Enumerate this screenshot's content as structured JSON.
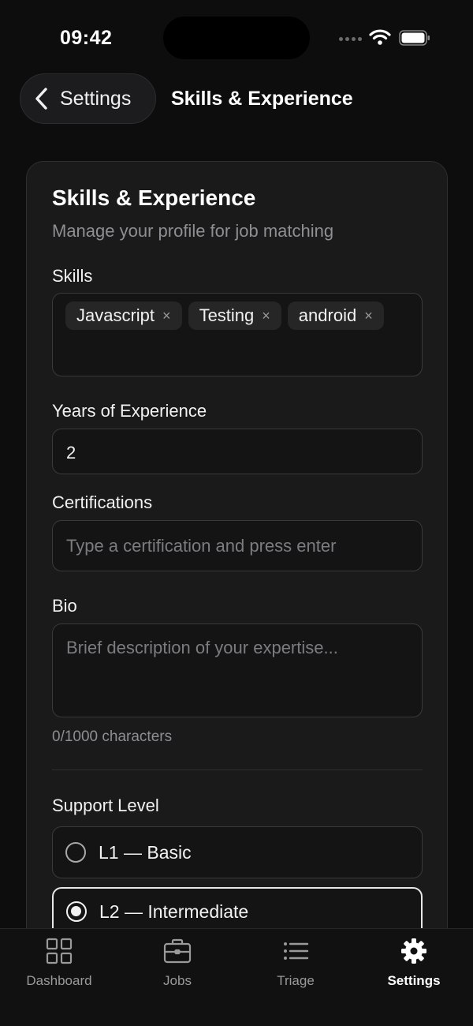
{
  "status_bar": {
    "time": "09:42"
  },
  "header": {
    "back_label": "Settings",
    "title": "Skills & Experience"
  },
  "card": {
    "title": "Skills & Experience",
    "subtitle": "Manage your profile for job matching",
    "skills": {
      "label": "Skills",
      "chips": [
        "Javascript",
        "Testing",
        "android"
      ],
      "remove_glyph": "×"
    },
    "years": {
      "label": "Years of Experience",
      "value": "2"
    },
    "certifications": {
      "label": "Certifications",
      "placeholder": "Type a certification and press enter"
    },
    "bio": {
      "label": "Bio",
      "placeholder": "Brief description of your expertise...",
      "char_count": "0/1000 characters"
    },
    "support_level": {
      "label": "Support Level",
      "options": [
        {
          "label": "L1 — Basic",
          "selected": false
        },
        {
          "label": "L2 — Intermediate",
          "selected": true
        }
      ]
    }
  },
  "tab_bar": {
    "tabs": [
      {
        "label": "Dashboard",
        "icon": "grid-icon",
        "active": false
      },
      {
        "label": "Jobs",
        "icon": "briefcase-icon",
        "active": false
      },
      {
        "label": "Triage",
        "icon": "list-icon",
        "active": false
      },
      {
        "label": "Settings",
        "icon": "gear-icon",
        "active": true
      }
    ]
  },
  "colors": {
    "background": "#0d0d0d",
    "card": "#1a1a1a",
    "accent": "#ffffff",
    "muted": "#8e8e93"
  }
}
